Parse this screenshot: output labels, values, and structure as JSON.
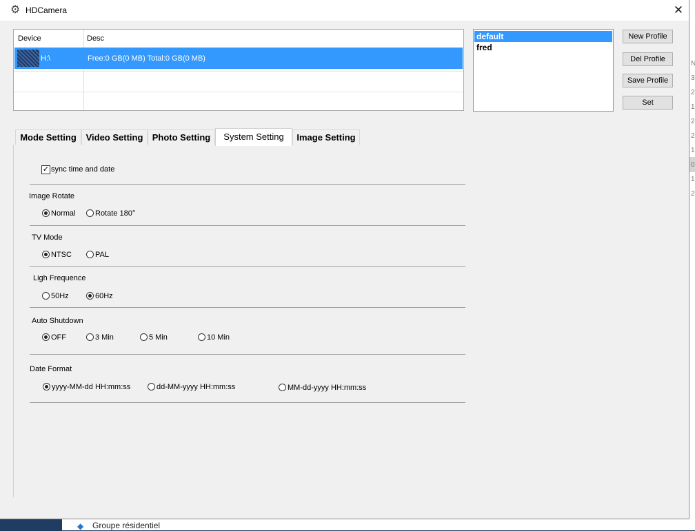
{
  "window": {
    "title": "HDCamera",
    "close_glyph": "✕",
    "icon": "gear-icon"
  },
  "device_table": {
    "headers": {
      "device": "Device",
      "desc": "Desc"
    },
    "rows": [
      {
        "device": "H:\\",
        "desc": "Free:0 GB(0 MB) Total:0 GB(0 MB)"
      }
    ]
  },
  "profiles": {
    "items": [
      "default",
      "fred"
    ],
    "selected": "default"
  },
  "buttons": {
    "new": "New Profile",
    "del": "Del Profile",
    "save": "Save Profile",
    "set": "Set"
  },
  "tabs": [
    "Mode Setting",
    "Video Setting",
    "Photo Setting",
    "System Setting",
    "Image Setting"
  ],
  "active_tab": "System Setting",
  "system": {
    "sync_label": "sync time and date",
    "sync_checked": true,
    "image_rotate": {
      "title": "Image Rotate",
      "options": [
        "Normal",
        "Rotate 180°"
      ],
      "selected": "Normal"
    },
    "tv_mode": {
      "title": "TV Mode",
      "options": [
        "NTSC",
        "PAL"
      ],
      "selected": "NTSC"
    },
    "light_frequence": {
      "title": "Ligh Frequence",
      "options": [
        "50Hz",
        "60Hz"
      ],
      "selected": "60Hz"
    },
    "auto_shutdown": {
      "title": "Auto Shutdown",
      "options": [
        "OFF",
        "3 Min",
        "5 Min",
        "10 Min"
      ],
      "selected": "OFF"
    },
    "date_format": {
      "title": "Date Format",
      "options": [
        "yyyy-MM-dd HH:mm:ss",
        "dd-MM-yyyy HH:mm:ss",
        "MM-dd-yyyy HH:mm:ss"
      ],
      "selected": "yyyy-MM-dd HH:mm:ss"
    }
  },
  "background": {
    "side_digits": [
      "N",
      "3",
      "2",
      "1",
      "2",
      "2",
      "1",
      "0",
      "1",
      "2"
    ],
    "taskbar_text": "Groupe résidentiel"
  },
  "colors": {
    "selection": "#3399ff",
    "window_bg": "#f0f0f0",
    "desktop": "#1f3c63"
  }
}
